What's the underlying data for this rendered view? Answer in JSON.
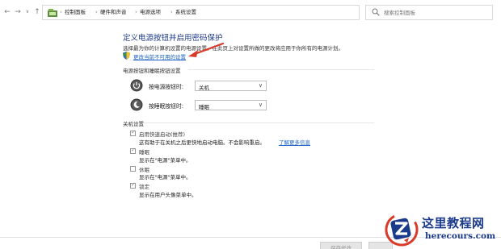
{
  "address_bar": {
    "breadcrumbs": [
      "控制面板",
      "硬件和声音",
      "电源选项",
      "系统设置"
    ],
    "separator": "›"
  },
  "search": {
    "placeholder": "搜索控制面板"
  },
  "page": {
    "title": "定义电源按钮并启用密码保护",
    "description": "选择最为你的计算机设置的电源设置。在此页上对设置所做的更改将应用于你所有的电源计划。",
    "unlock_link": "更改当前不可用的设置"
  },
  "power_buttons": {
    "section_label": "电源按钮和睡眠按钮设置",
    "rows": [
      {
        "label": "按电源按钮时:",
        "value": "关机",
        "icon": "power-icon"
      },
      {
        "label": "按睡眠按钮时:",
        "value": "睡眠",
        "icon": "sleep-icon"
      }
    ]
  },
  "shutdown": {
    "section_label": "关机设置",
    "options": [
      {
        "label": "启用快速启动(推荐)",
        "desc": "这有助于在关机之后更快地启动电脑。不会影响重启。",
        "checked": true
      },
      {
        "label": "睡眠",
        "desc": "显示在\"电源\"菜单中。",
        "checked": true
      },
      {
        "label": "休眠",
        "desc": "显示在\"电源\"菜单中。",
        "checked": false
      },
      {
        "label": "锁定",
        "desc": "显示在用户头像菜单中。",
        "checked": true
      }
    ],
    "learn_more": "了解更多信息"
  },
  "buttons": {
    "save": "保存修改"
  },
  "watermark": {
    "title": "这里教程网",
    "url": "herecours.com"
  },
  "colors": {
    "title": "#1e3a8a",
    "link": "#1a62c6",
    "arrow": "#d93a2a",
    "watermark": "#1b3a8a"
  }
}
